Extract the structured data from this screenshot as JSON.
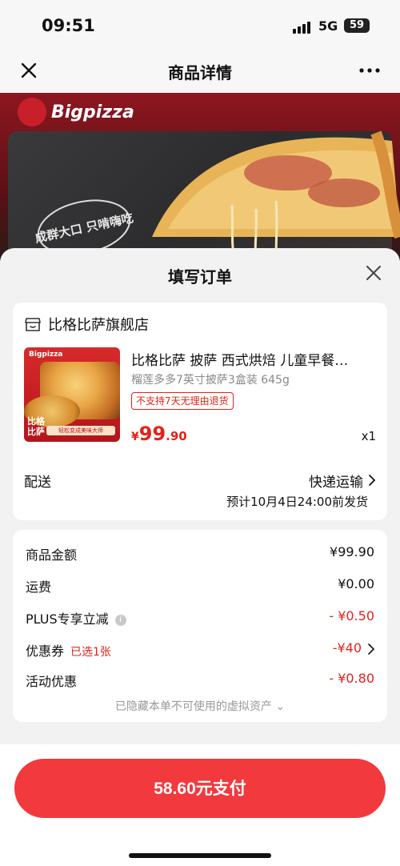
{
  "status_bar": {
    "time": "09:51",
    "network": "5G",
    "battery": "59"
  },
  "nav": {
    "title": "商品详情"
  },
  "banner": {
    "brand": "Bigpizza",
    "stamp_text": "成群大口 只啃嗨吃"
  },
  "sheet": {
    "title": "填写订单"
  },
  "store": {
    "name": "比格比萨旗舰店"
  },
  "product": {
    "thumb_brand": "Bigpizza",
    "thumb_side": "比格\n比萨",
    "thumb_strip": "轻松变成美味大师",
    "title": "比格比萨 披萨 西式烘焙 儿童早餐…",
    "spec": "榴莲多多7英寸披萨3盒装 645g",
    "tag": "不支持7天无理由退货",
    "price_currency": "¥",
    "price_int": "99",
    "price_dec": ".90",
    "quantity": "x1"
  },
  "shipping": {
    "label": "配送",
    "method": "快递运输",
    "eta": "预计10月4日24:00前发货"
  },
  "summary": {
    "goods_label": "商品金额",
    "goods_value": "¥99.90",
    "freight_label": "运费",
    "freight_value": "¥0.00",
    "plus_label": "PLUS专享立减",
    "plus_value": "- ¥0.50",
    "coupon_label": "优惠券",
    "coupon_selected": "已选1张",
    "coupon_value": "-¥40",
    "promo_label": "活动优惠",
    "promo_value": "- ¥0.80",
    "hidden_assets": "已隐藏本单不可使用的虚拟资产 ⌄"
  },
  "footer": {
    "pay_label": "58.60元支付"
  },
  "colors": {
    "accent": "#e2231a",
    "pay_button": "#f2393d"
  }
}
